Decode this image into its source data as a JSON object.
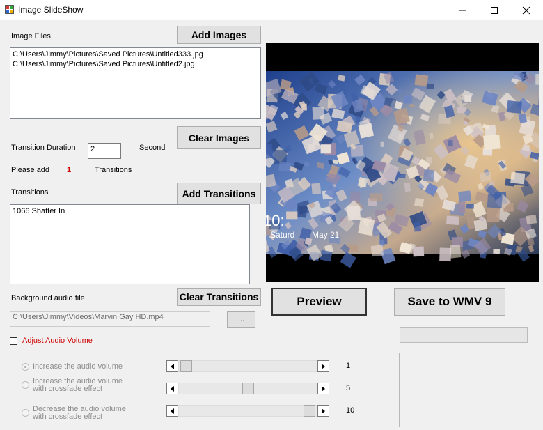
{
  "window": {
    "title": "Image SlideShow"
  },
  "image_files": {
    "label": "Image Files",
    "items": [
      "C:\\Users\\Jimmy\\Pictures\\Saved Pictures\\Untitled333.jpg",
      "C:\\Users\\Jimmy\\Pictures\\Saved Pictures\\Untitled2.jpg"
    ]
  },
  "buttons": {
    "add_images": "Add Images",
    "clear_images": "Clear Images",
    "add_transitions": "Add Transitions",
    "clear_transitions": "Clear Transitions",
    "preview": "Preview",
    "save": "Save to WMV 9",
    "browse": "..."
  },
  "transition": {
    "duration_label": "Transition Duration",
    "duration_value": "2",
    "unit_label": "Second",
    "please_add_label": "Please add",
    "please_add_count": "1",
    "transitions_word": "Transitions"
  },
  "transitions_list": {
    "label": "Transitions",
    "items": [
      "1066 Shatter In"
    ]
  },
  "audio": {
    "label": "Background audio file",
    "path": "C:\\Users\\Jimmy\\Videos\\Marvin Gay HD.mp4",
    "adjust_label": "Adjust Audio Volume",
    "adjust_checked": false,
    "options": [
      {
        "label_line1": "Increase the audio volume",
        "label_line2": "",
        "value": "1",
        "level": 0.0,
        "checked": true
      },
      {
        "label_line1": "Increase the audio volume",
        "label_line2": "with crossfade effect",
        "value": "5",
        "level": 0.5,
        "checked": false
      },
      {
        "label_line1": "Decrease the audio volume",
        "label_line2": "with crossfade effect",
        "value": "10",
        "level": 1.0,
        "checked": false
      }
    ]
  },
  "preview_overlay": {
    "clock": "10:",
    "day": "Saturd",
    "date": "May 21"
  },
  "colors": {
    "accent_red": "#cc0000",
    "window_bg": "#f0f0f0"
  }
}
